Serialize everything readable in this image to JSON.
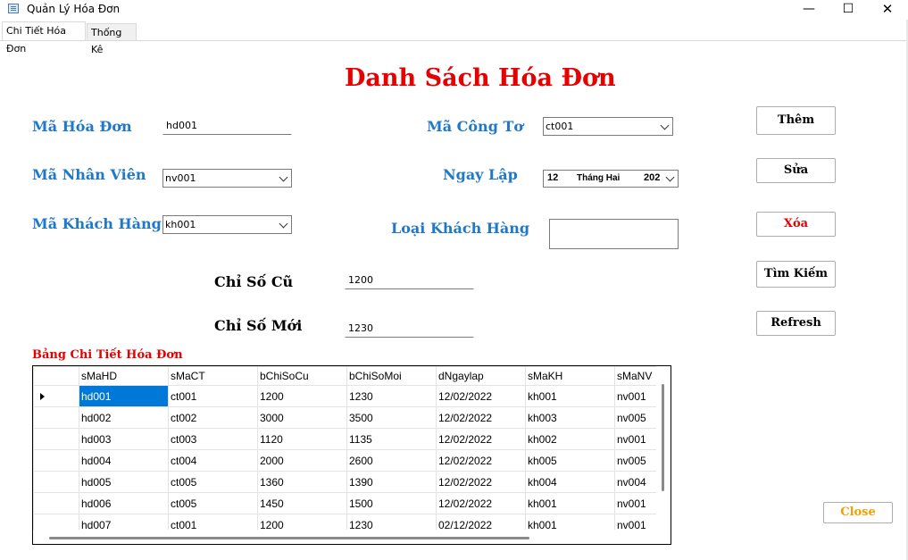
{
  "window": {
    "title": "Quản Lý Hóa Đơn",
    "minimize_glyph": "—",
    "maximize_glyph": "☐",
    "close_glyph": "✕"
  },
  "tabs": [
    {
      "label": "Chi Tiết Hóa Đơn",
      "active": true
    },
    {
      "label": "Thống Kê",
      "active": false
    }
  ],
  "heading": "Danh Sách Hóa Đơn",
  "form": {
    "ma_hoa_don": {
      "label": "Mã Hóa Đơn",
      "value": "hd001"
    },
    "ma_nhan_vien": {
      "label": "Mã Nhân Viên",
      "value": "nv001"
    },
    "ma_khach_hang": {
      "label": "Mã Khách Hàng",
      "value": "kh001"
    },
    "ma_cong_to": {
      "label": "Mã Công Tơ",
      "value": "ct001"
    },
    "ngay_lap": {
      "label": "Ngay Lập",
      "day": "12",
      "month": "Tháng Hai",
      "year": "202"
    },
    "loai_khach_hang": {
      "label": "Loại Khách Hàng",
      "value": ""
    },
    "chi_so_cu": {
      "label": "Chỉ Số Cũ",
      "value": "1200"
    },
    "chi_so_moi": {
      "label": "Chỉ Số Mới",
      "value": "1230"
    }
  },
  "buttons": {
    "them": "Thêm",
    "sua": "Sửa",
    "xoa": "Xóa",
    "tim_kiem": "Tìm Kiếm",
    "refresh": "Refresh",
    "close": "Close"
  },
  "colors": {
    "heading": "#e60000",
    "label": "#1f78c8",
    "selection": "#0078d7",
    "close_text": "#f0a000"
  },
  "grid": {
    "title": "Bảng Chi Tiết Hóa Đơn",
    "columns": [
      "sMaHD",
      "sMaCT",
      "bChiSoCu",
      "bChiSoMoi",
      "dNgaylap",
      "sMaKH",
      "sMaNV"
    ],
    "rows": [
      [
        "hd001",
        "ct001",
        "1200",
        "1230",
        "12/02/2022",
        "kh001",
        "nv001"
      ],
      [
        "hd002",
        "ct002",
        "3000",
        "3500",
        "12/02/2022",
        "kh003",
        "nv005"
      ],
      [
        "hd003",
        "ct003",
        "1120",
        "1135",
        "12/02/2022",
        "kh002",
        "nv001"
      ],
      [
        "hd004",
        "ct004",
        "2000",
        "2600",
        "12/02/2022",
        "kh005",
        "nv005"
      ],
      [
        "hd005",
        "ct005",
        "1360",
        "1390",
        "12/02/2022",
        "kh004",
        "nv004"
      ],
      [
        "hd006",
        "ct005",
        "1450",
        "1500",
        "12/02/2022",
        "kh001",
        "nv001"
      ],
      [
        "hd007",
        "ct001",
        "1200",
        "1230",
        "02/12/2022",
        "kh001",
        "nv001"
      ]
    ]
  }
}
